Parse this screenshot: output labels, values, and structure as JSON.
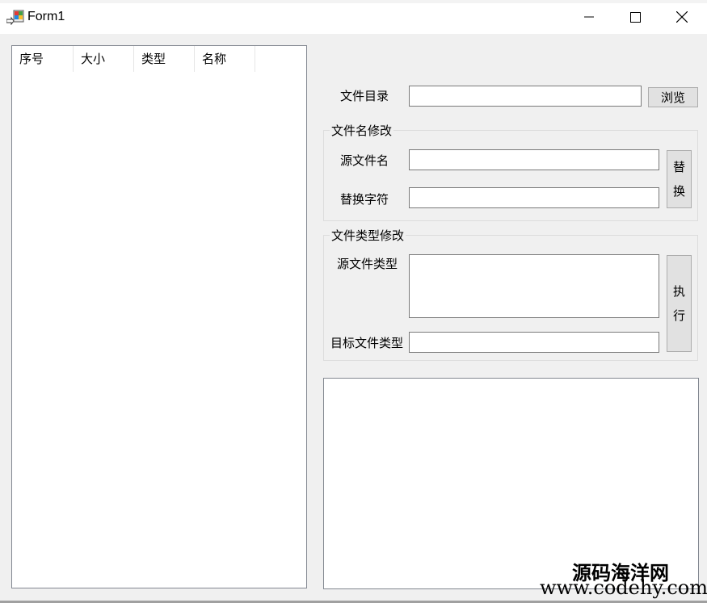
{
  "window": {
    "title": "Form1",
    "controls": {
      "minimize_icon": "minimize-icon",
      "maximize_icon": "maximize-icon",
      "close_icon": "close-icon"
    }
  },
  "file_list": {
    "columns": [
      "序号",
      "大小",
      "类型",
      "名称"
    ]
  },
  "directory": {
    "label": "文件目录",
    "value": "",
    "browse_label": "浏览"
  },
  "rename_group": {
    "title": "文件名修改",
    "source_label": "源文件名",
    "source_value": "",
    "replace_label": "替换字符",
    "replace_value": "",
    "button_chars": [
      "替",
      "换"
    ]
  },
  "type_group": {
    "title": "文件类型修改",
    "source_label": "源文件类型",
    "source_value": "",
    "target_label": "目标文件类型",
    "target_value": "",
    "button_chars": [
      "执",
      "行"
    ]
  },
  "output_log": {
    "value": ""
  },
  "watermark": {
    "line1": "源码海洋网",
    "line2": "www.codehy.com"
  }
}
